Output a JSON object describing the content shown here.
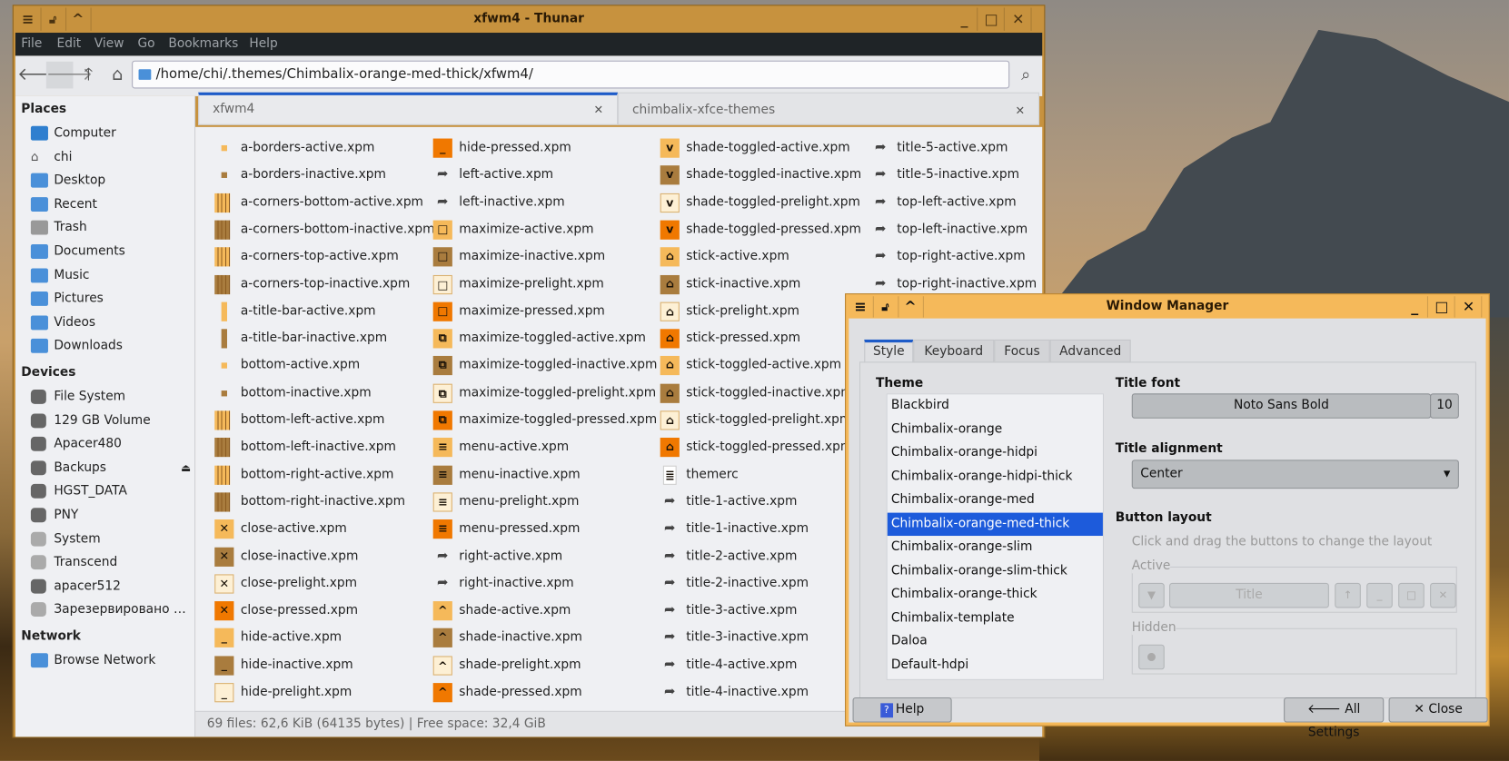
{
  "thunar": {
    "title": "xfwm4 - Thunar",
    "menu": [
      "File",
      "Edit",
      "View",
      "Go",
      "Bookmarks",
      "Help"
    ],
    "location": "/home/chi/.themes/Chimbalix-orange-med-thick/xfwm4/",
    "sidebar": {
      "places_label": "Places",
      "places": [
        {
          "label": "Computer",
          "icon": "computer"
        },
        {
          "label": "chi",
          "icon": "home"
        },
        {
          "label": "Desktop",
          "icon": "desktop"
        },
        {
          "label": "Recent",
          "icon": "recent"
        },
        {
          "label": "Trash",
          "icon": "trash"
        },
        {
          "label": "Documents",
          "icon": "documents"
        },
        {
          "label": "Music",
          "icon": "music"
        },
        {
          "label": "Pictures",
          "icon": "pictures"
        },
        {
          "label": "Videos",
          "icon": "videos"
        },
        {
          "label": "Downloads",
          "icon": "downloads"
        }
      ],
      "devices_label": "Devices",
      "devices": [
        "File System",
        "129 GB Volume",
        "Apacer480",
        "Backups",
        "HGST_DATA",
        "PNY",
        "System",
        "Transcend",
        "apacer512",
        "Зарезервировано с..."
      ],
      "network_label": "Network",
      "network": [
        "Browse Network"
      ]
    },
    "tabs": [
      "xfwm4",
      "chimbalix-xfce-themes"
    ],
    "files": [
      [
        "a-borders-active.xpm",
        "a-borders-inactive.xpm",
        "a-corners-bottom-active.xpm",
        "a-corners-bottom-inactive.xpm",
        "a-corners-top-active.xpm",
        "a-corners-top-inactive.xpm",
        "a-title-bar-active.xpm",
        "a-title-bar-inactive.xpm",
        "bottom-active.xpm",
        "bottom-inactive.xpm",
        "bottom-left-active.xpm",
        "bottom-left-inactive.xpm",
        "bottom-right-active.xpm",
        "bottom-right-inactive.xpm",
        "close-active.xpm",
        "close-inactive.xpm",
        "close-prelight.xpm",
        "close-pressed.xpm",
        "hide-active.xpm",
        "hide-inactive.xpm",
        "hide-prelight.xpm"
      ],
      [
        "hide-pressed.xpm",
        "left-active.xpm",
        "left-inactive.xpm",
        "maximize-active.xpm",
        "maximize-inactive.xpm",
        "maximize-prelight.xpm",
        "maximize-pressed.xpm",
        "maximize-toggled-active.xpm",
        "maximize-toggled-inactive.xpm",
        "maximize-toggled-prelight.xpm",
        "maximize-toggled-pressed.xpm",
        "menu-active.xpm",
        "menu-inactive.xpm",
        "menu-prelight.xpm",
        "menu-pressed.xpm",
        "right-active.xpm",
        "right-inactive.xpm",
        "shade-active.xpm",
        "shade-inactive.xpm",
        "shade-prelight.xpm",
        "shade-pressed.xpm"
      ],
      [
        "shade-toggled-active.xpm",
        "shade-toggled-inactive.xpm",
        "shade-toggled-prelight.xpm",
        "shade-toggled-pressed.xpm",
        "stick-active.xpm",
        "stick-inactive.xpm",
        "stick-prelight.xpm",
        "stick-pressed.xpm",
        "stick-toggled-active.xpm",
        "stick-toggled-inactive.xpm",
        "stick-toggled-prelight.xpm",
        "stick-toggled-pressed.xpm",
        "themerc",
        "title-1-active.xpm",
        "title-1-inactive.xpm",
        "title-2-active.xpm",
        "title-2-inactive.xpm",
        "title-3-active.xpm",
        "title-3-inactive.xpm",
        "title-4-active.xpm",
        "title-4-inactive.xpm"
      ],
      [
        "title-5-active.xpm",
        "title-5-inactive.xpm",
        "top-left-active.xpm",
        "top-left-inactive.xpm",
        "top-right-active.xpm",
        "top-right-inactive.xpm"
      ]
    ],
    "status": "69 files: 62,6 KiB (64135 bytes)  |  Free space: 32,4 GiB"
  },
  "wm": {
    "title": "Window Manager",
    "tabs": [
      "Style",
      "Keyboard",
      "Focus",
      "Advanced"
    ],
    "theme_label": "Theme",
    "themes": [
      "Blackbird",
      "Chimbalix-orange",
      "Chimbalix-orange-hidpi",
      "Chimbalix-orange-hidpi-thick",
      "Chimbalix-orange-med",
      "Chimbalix-orange-med-thick",
      "Chimbalix-orange-slim",
      "Chimbalix-orange-slim-thick",
      "Chimbalix-orange-thick",
      "Chimbalix-template",
      "Daloa",
      "Default-hdpi"
    ],
    "selected_theme": "Chimbalix-orange-med-thick",
    "title_font_label": "Title font",
    "font_name": "Noto Sans Bold",
    "font_size": "10",
    "title_alignment_label": "Title alignment",
    "title_alignment": "Center",
    "button_layout_label": "Button layout",
    "button_layout_hint": "Click and drag the buttons to change the layout",
    "active_label": "Active",
    "title_button": "Title",
    "hidden_label": "Hidden",
    "help": "Help",
    "all_settings": "All Settings",
    "close": "Close"
  },
  "colors": {
    "accent": "#1d5bdb",
    "titlebar_active": "#f5b95a",
    "titlebar_inactive": "#c7923e",
    "pressed": "#f07800"
  }
}
